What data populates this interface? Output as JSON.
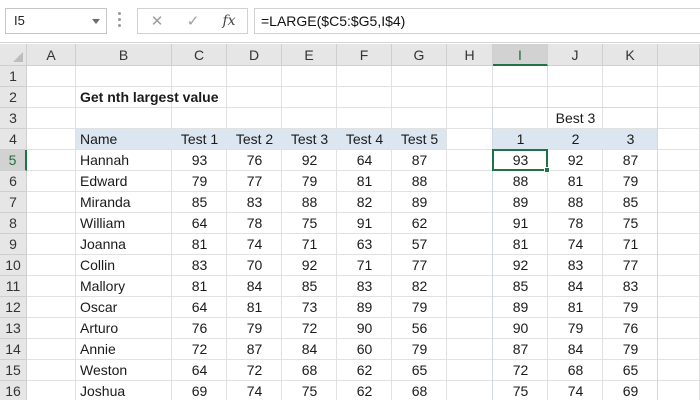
{
  "formula_bar": {
    "name_box": "I5",
    "formula": "=LARGE($C5:$G5,I$4)",
    "cancel_icon": "cancel-icon",
    "enter_icon": "checkmark-icon",
    "fx_label": "fx"
  },
  "columns": [
    "A",
    "B",
    "C",
    "D",
    "E",
    "F",
    "G",
    "H",
    "I",
    "J",
    "K"
  ],
  "rows": [
    "1",
    "2",
    "3",
    "4",
    "5",
    "6",
    "7",
    "8",
    "9",
    "10",
    "11",
    "12",
    "13",
    "14",
    "15",
    "16"
  ],
  "selected_cell": {
    "column": "I",
    "row": "5"
  },
  "sheet": {
    "title": "Get nth largest value",
    "headers": [
      "Name",
      "Test 1",
      "Test 2",
      "Test 3",
      "Test 4",
      "Test 5"
    ],
    "data": [
      [
        "Hannah",
        93,
        76,
        92,
        64,
        87
      ],
      [
        "Edward",
        79,
        77,
        79,
        81,
        88
      ],
      [
        "Miranda",
        85,
        83,
        88,
        82,
        89
      ],
      [
        "William",
        64,
        78,
        75,
        91,
        62
      ],
      [
        "Joanna",
        81,
        74,
        71,
        63,
        57
      ],
      [
        "Collin",
        83,
        70,
        92,
        71,
        77
      ],
      [
        "Mallory",
        81,
        84,
        85,
        83,
        82
      ],
      [
        "Oscar",
        64,
        81,
        73,
        89,
        79
      ],
      [
        "Arturo",
        76,
        79,
        72,
        90,
        56
      ],
      [
        "Annie",
        72,
        87,
        84,
        60,
        79
      ],
      [
        "Weston",
        64,
        72,
        68,
        62,
        65
      ],
      [
        "Joshua",
        69,
        74,
        75,
        62,
        68
      ]
    ],
    "best_label": "Best 3",
    "best_headers": [
      1,
      2,
      3
    ],
    "best": [
      [
        93,
        92,
        87
      ],
      [
        88,
        81,
        79
      ],
      [
        89,
        88,
        85
      ],
      [
        91,
        78,
        75
      ],
      [
        81,
        74,
        71
      ],
      [
        92,
        83,
        77
      ],
      [
        85,
        84,
        83
      ],
      [
        89,
        81,
        79
      ],
      [
        90,
        79,
        76
      ],
      [
        87,
        84,
        79
      ],
      [
        72,
        68,
        65
      ],
      [
        75,
        74,
        69
      ]
    ]
  },
  "colors": {
    "header_fill": "#dbe6f1",
    "selection": "#217346",
    "gridline": "#e1e1e1"
  }
}
